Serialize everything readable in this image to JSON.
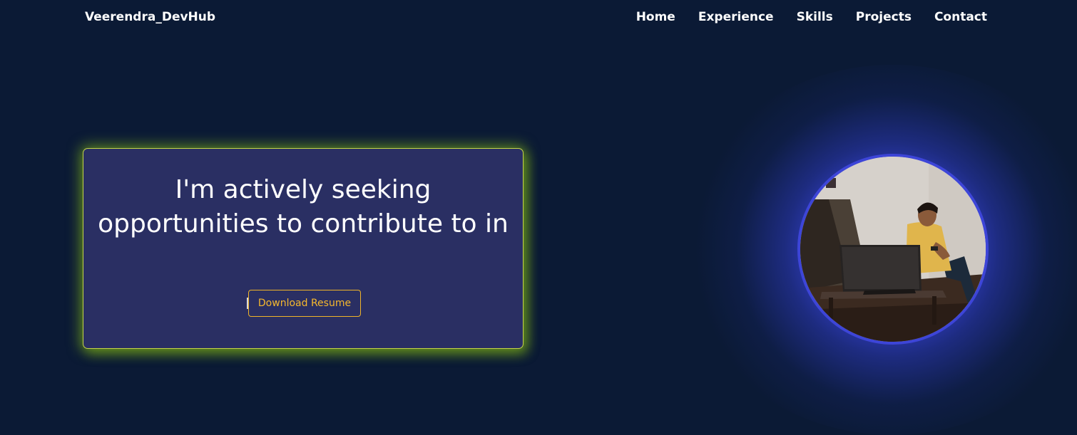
{
  "header": {
    "brand": "Veerendra_DevHub",
    "nav": [
      "Home",
      "Experience",
      "Skills",
      "Projects",
      "Contact"
    ]
  },
  "hero": {
    "headline": "I'm actively seeking opportunities to contribute to in",
    "resume_button": "Download Resume"
  },
  "colors": {
    "background": "#0b1a35",
    "card": "#2a2f63",
    "card_glow": "#96cd14",
    "button_accent": "#f0b429",
    "photo_glow": "#4650ff"
  }
}
